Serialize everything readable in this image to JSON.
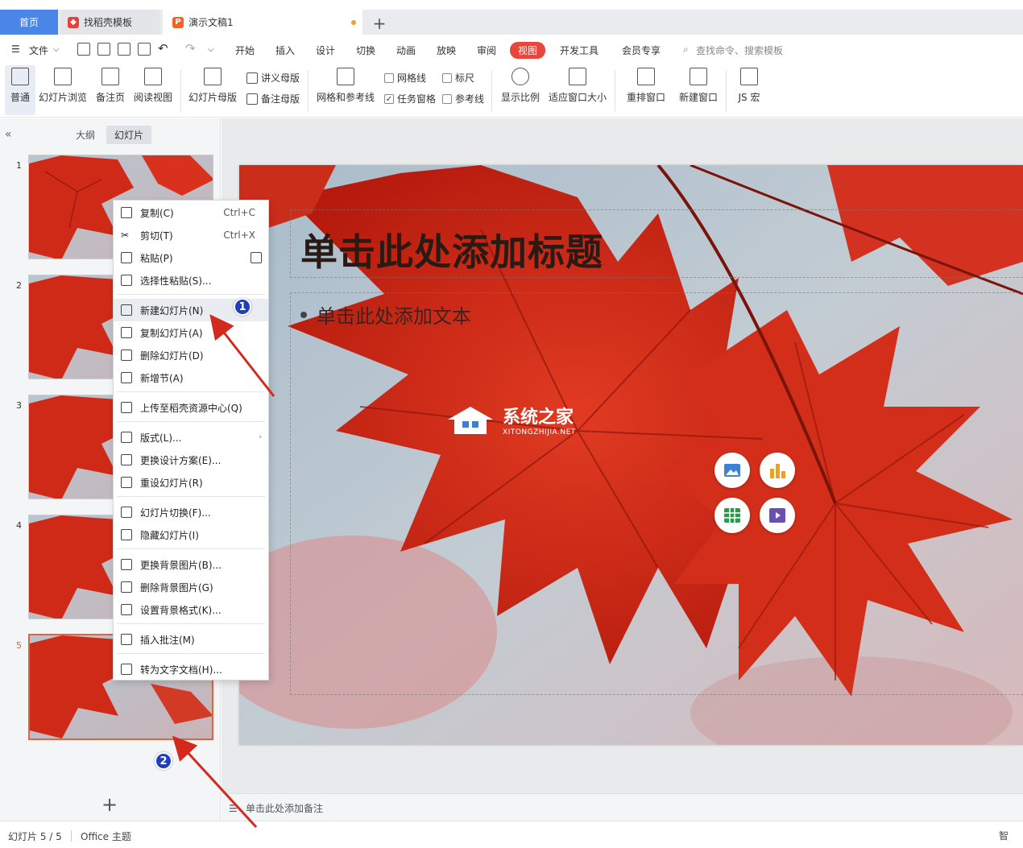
{
  "tabs": {
    "home": "首页",
    "template": "找稻壳模板",
    "document": "演示文稿1"
  },
  "menubar": {
    "file": "文件",
    "items": [
      "开始",
      "插入",
      "设计",
      "切换",
      "动画",
      "放映",
      "审阅",
      "视图",
      "开发工具",
      "会员专享"
    ],
    "active": "视图",
    "search_placeholder": "查找命令、搜索模板"
  },
  "ribbon": {
    "normal": "普通",
    "slide_browse": "幻灯片浏览",
    "notes_page": "备注页",
    "reading_view": "阅读视图",
    "slide_master": "幻灯片母版",
    "handout_master": "讲义母版",
    "notes_master": "备注母版",
    "grid_guides": "网格和参考线",
    "gridlines": "网格线",
    "ruler": "标尺",
    "task_pane": "任务窗格",
    "guides": "参考线",
    "zoom": "显示比例",
    "fit_window": "适应窗口大小",
    "arrange": "重排窗口",
    "new_window": "新建窗口",
    "js_macro": "JS 宏"
  },
  "left_panel": {
    "outline": "大纲",
    "slides": "幻灯片",
    "slide_numbers": [
      "1",
      "2",
      "3",
      "4",
      "5"
    ],
    "selected_slide": 5
  },
  "slide": {
    "title_placeholder": "单击此处添加标题",
    "body_placeholder": "单击此处添加文本"
  },
  "watermark": {
    "title": "系统之家",
    "subtitle": "XITONGZHIJIA.NET"
  },
  "notes": {
    "placeholder": "单击此处添加备注"
  },
  "status": {
    "slide_counter": "幻灯片 5 / 5",
    "theme": "Office 主题",
    "right": "智"
  },
  "context_menu": {
    "items": [
      {
        "label": "复制(C)",
        "shortcut": "Ctrl+C"
      },
      {
        "label": "剪切(T)",
        "shortcut": "Ctrl+X"
      },
      {
        "label": "粘贴(P)",
        "shortcut": ""
      },
      {
        "label": "选择性粘贴(S)...",
        "shortcut": ""
      },
      {
        "label": "新建幻灯片(N)",
        "shortcut": ""
      },
      {
        "label": "复制幻灯片(A)",
        "shortcut": ""
      },
      {
        "label": "删除幻灯片(D)",
        "shortcut": ""
      },
      {
        "label": "新增节(A)",
        "shortcut": ""
      },
      {
        "label": "上传至稻壳资源中心(Q)",
        "shortcut": ""
      },
      {
        "label": "版式(L)...",
        "shortcut": ""
      },
      {
        "label": "更换设计方案(E)...",
        "shortcut": ""
      },
      {
        "label": "重设幻灯片(R)",
        "shortcut": ""
      },
      {
        "label": "幻灯片切换(F)...",
        "shortcut": ""
      },
      {
        "label": "隐藏幻灯片(I)",
        "shortcut": ""
      },
      {
        "label": "更换背景图片(B)...",
        "shortcut": ""
      },
      {
        "label": "删除背景图片(G)",
        "shortcut": ""
      },
      {
        "label": "设置背景格式(K)...",
        "shortcut": ""
      },
      {
        "label": "插入批注(M)",
        "shortcut": ""
      },
      {
        "label": "转为文字文档(H)...",
        "shortcut": ""
      }
    ]
  },
  "annotations": {
    "badge1": "1",
    "badge2": "2"
  },
  "colors": {
    "accent": "#e8453c",
    "home_tab": "#4a86e8",
    "selection_border": "#e8603c",
    "badge": "#1f3fbf",
    "arrow": "#d42a1e"
  }
}
